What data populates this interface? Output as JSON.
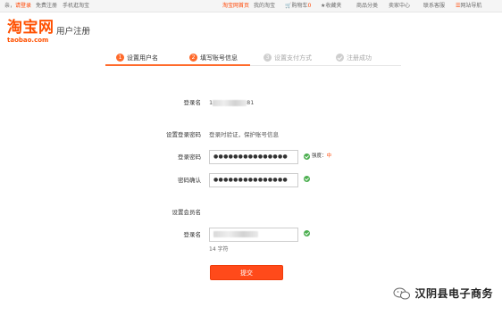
{
  "topbar": {
    "left_prefix": "亲，",
    "login_prompt": "请登录",
    "free_register": "免费注册",
    "mobile_taobao": "手机逛淘宝",
    "home": "淘宝网首页",
    "my_taobao": "我的淘宝",
    "cart": "购物车",
    "cart_count": "0",
    "favorites": "收藏夹",
    "categories": "商品分类",
    "seller_center": "卖家中心",
    "contact_service": "联系客服",
    "site_nav": "网站导航"
  },
  "logo": {
    "cn": "淘宝网",
    "en": "taobao.com"
  },
  "page_title": "用户注册",
  "steps": [
    {
      "num": "1",
      "label": "设置用户名",
      "state": "done"
    },
    {
      "num": "2",
      "label": "填写账号信息",
      "state": "active"
    },
    {
      "num": "3",
      "label": "设置支付方式",
      "state": "pending"
    },
    {
      "num": "",
      "label": "注册成功",
      "state": "pending"
    }
  ],
  "form": {
    "login_name_label": "登录名",
    "login_name_prefix": "1",
    "login_name_suffix": "81",
    "section_password": "设置登录密码",
    "password_hint": "登录时验证，保护账号信息",
    "password_label": "登录密码",
    "password_value": "●●●●●●●●●●●●●●●",
    "strength_label": "强度：",
    "strength_value": "中",
    "confirm_label": "密码确认",
    "confirm_value": "●●●●●●●●●●●●●●●",
    "section_member": "设置会员名",
    "member_label": "登录名",
    "char_count": "14 字符",
    "submit_label": "提交"
  },
  "watermark": {
    "text": "汉阴县电子商务"
  },
  "colors": {
    "accent": "#ff4a1a",
    "step_active": "#ff6a2b",
    "ok": "#4caf50"
  }
}
